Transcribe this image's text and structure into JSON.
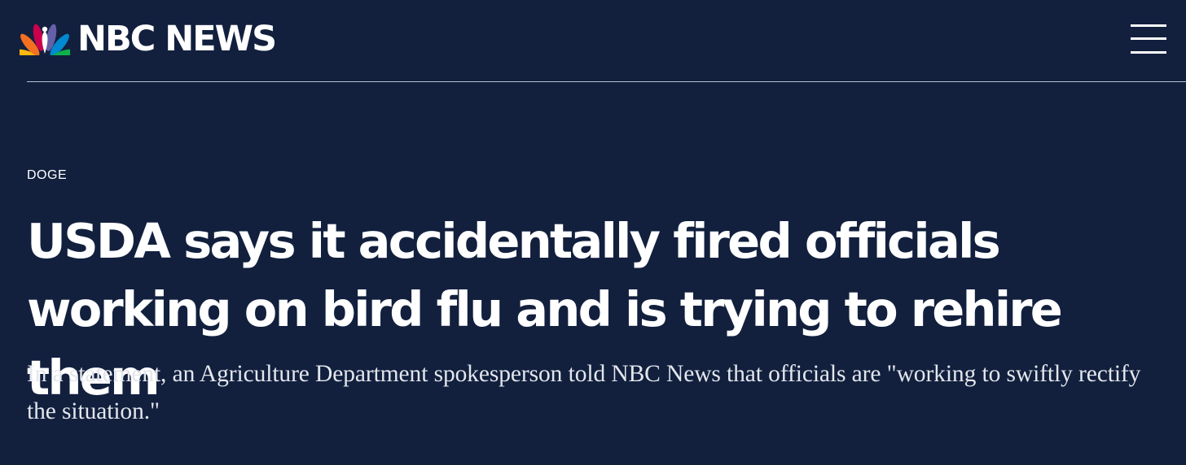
{
  "header": {
    "logo_text": "NBC NEWS",
    "logo_icon": "nbc-peacock-icon",
    "menu_icon": "hamburger-menu-icon"
  },
  "article": {
    "category": "DOGE",
    "headline": "USDA says it accidentally fired officials working on bird flu and is trying to rehire them",
    "dek": "In a statement, an Agriculture Department spokesperson told NBC News that officials are \"working to swiftly rectify the situation.\""
  },
  "colors": {
    "background": "#12203e",
    "text": "#ffffff",
    "divider": "#b8c0cf",
    "peacock": [
      "#fcb711",
      "#f37021",
      "#cc004c",
      "#6460aa",
      "#0089d0",
      "#0db14b"
    ]
  }
}
